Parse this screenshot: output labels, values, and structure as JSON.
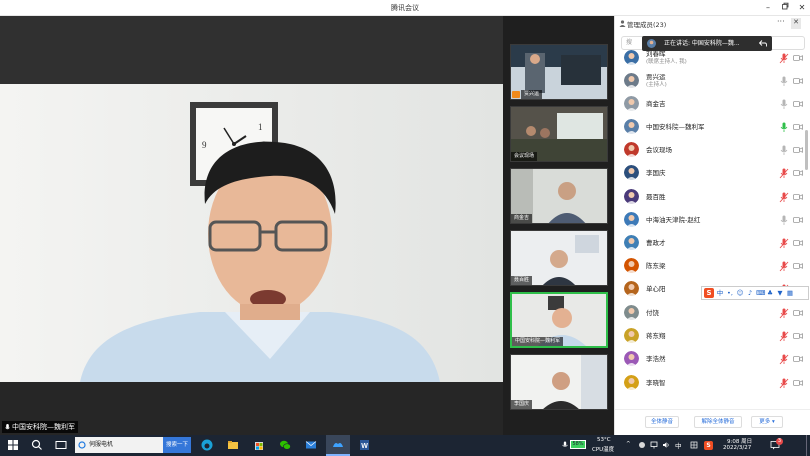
{
  "window": {
    "title": "腾讯会议"
  },
  "main_video": {
    "speaker_label": "中国安科院—魏利军"
  },
  "thumbnails": [
    {
      "label": "贾兴运",
      "is_host": true,
      "active": false
    },
    {
      "label": "会议现场",
      "is_host": false,
      "active": false
    },
    {
      "label": "商金吉",
      "is_host": false,
      "active": false
    },
    {
      "label": "聂百胜",
      "is_host": false,
      "active": false
    },
    {
      "label": "中国安科院—魏利军",
      "is_host": false,
      "active": true
    },
    {
      "label": "李国庆",
      "is_host": false,
      "active": false
    }
  ],
  "panel": {
    "title": "管理成员(23)",
    "search_placeholder": "搜",
    "speaking_tip": "正在讲话: 中国安科院—魏...",
    "members": [
      {
        "name": "刘春晖",
        "role": "(联席主持人, 我)",
        "mic": "muted",
        "avatar_color": "#3a6ea5"
      },
      {
        "name": "贾兴运",
        "role": "(主持人)",
        "mic": "off",
        "avatar_color": "#6d7b8a"
      },
      {
        "name": "商金吉",
        "role": "",
        "mic": "off",
        "avatar_color": "#8f9aa5"
      },
      {
        "name": "中国安科院—魏利军",
        "role": "",
        "mic": "speaking",
        "avatar_color": "#5a7fa8"
      },
      {
        "name": "会议现场",
        "role": "",
        "mic": "off",
        "avatar_color": "#c0392b"
      },
      {
        "name": "李国庆",
        "role": "",
        "mic": "muted",
        "avatar_color": "#2c4f7c"
      },
      {
        "name": "聂百胜",
        "role": "",
        "mic": "muted",
        "avatar_color": "#4a3a7a"
      },
      {
        "name": "中海油天津院-赵红",
        "role": "",
        "mic": "off",
        "avatar_color": "#3d7ab8"
      },
      {
        "name": "曹政才",
        "role": "",
        "mic": "muted",
        "avatar_color": "#3f7fb5"
      },
      {
        "name": "陈东梁",
        "role": "",
        "mic": "muted",
        "avatar_color": "#d35400"
      },
      {
        "name": "单心阳",
        "role": "",
        "mic": "muted",
        "avatar_color": "#b5651d"
      },
      {
        "name": "付饶",
        "role": "",
        "mic": "muted",
        "avatar_color": "#7f8c8d"
      },
      {
        "name": "蒋东翔",
        "role": "",
        "mic": "muted",
        "avatar_color": "#c9a227"
      },
      {
        "name": "李浩然",
        "role": "",
        "mic": "muted",
        "avatar_color": "#9b59b6"
      },
      {
        "name": "李晓智",
        "role": "",
        "mic": "muted",
        "avatar_color": "#d4a017"
      }
    ],
    "footer_buttons": [
      "全体静音",
      "解除全体静音",
      "更多 ▾"
    ]
  },
  "ime_bar": {
    "mode": "中"
  },
  "taskbar": {
    "search_text": "伺服电机",
    "search_button": "搜索一下",
    "battery": "58%",
    "weather_temp": "53°C",
    "weather_label": "CPU温度",
    "ime": "中",
    "time": "9:08 周日",
    "date": "2022/3/27",
    "notification_count": "3"
  },
  "colors": {
    "speaking_green": "#2fbf4a",
    "muted_red": "#e84a4a",
    "accent_blue": "#2a6fdb",
    "taskbar_bg": "#1c2533"
  }
}
